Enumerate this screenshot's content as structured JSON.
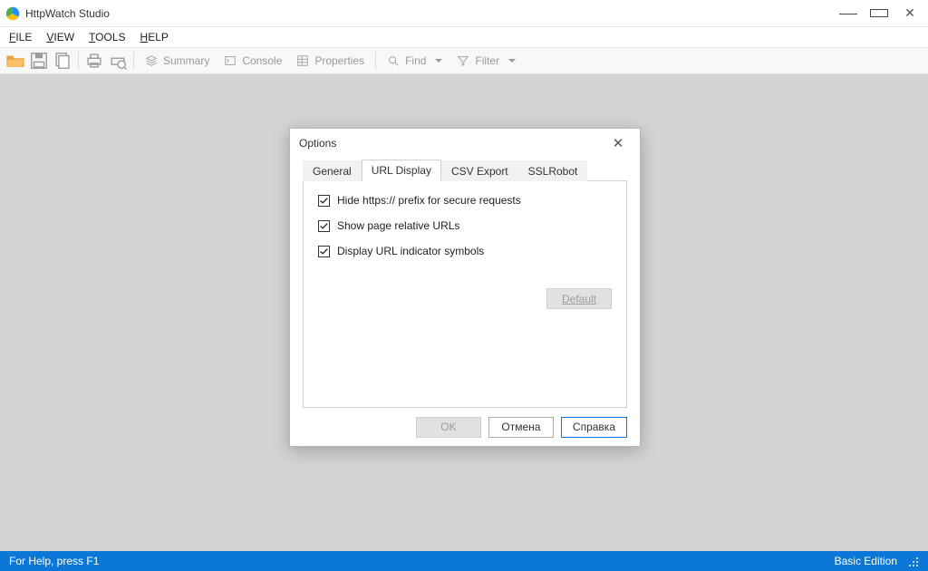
{
  "window": {
    "title": "HttpWatch Studio"
  },
  "menu": {
    "file": "FILE",
    "view": "VIEW",
    "tools": "TOOLS",
    "help": "HELP"
  },
  "toolbar": {
    "summary": "Summary",
    "console": "Console",
    "properties": "Properties",
    "find": "Find",
    "filter": "Filter"
  },
  "dialog": {
    "title": "Options",
    "tabs": {
      "general": "General",
      "url_display": "URL Display",
      "csv_export": "CSV Export",
      "sslrobot": "SSLRobot"
    },
    "checks": {
      "hide_https": "Hide https:// prefix for secure requests",
      "relative_urls": "Show page relative URLs",
      "indicator_symbols": "Display URL indicator symbols"
    },
    "buttons": {
      "default": "Default",
      "ok": "OK",
      "cancel": "Отмена",
      "help": "Справка"
    }
  },
  "status": {
    "help": "For Help, press F1",
    "edition": "Basic Edition"
  }
}
